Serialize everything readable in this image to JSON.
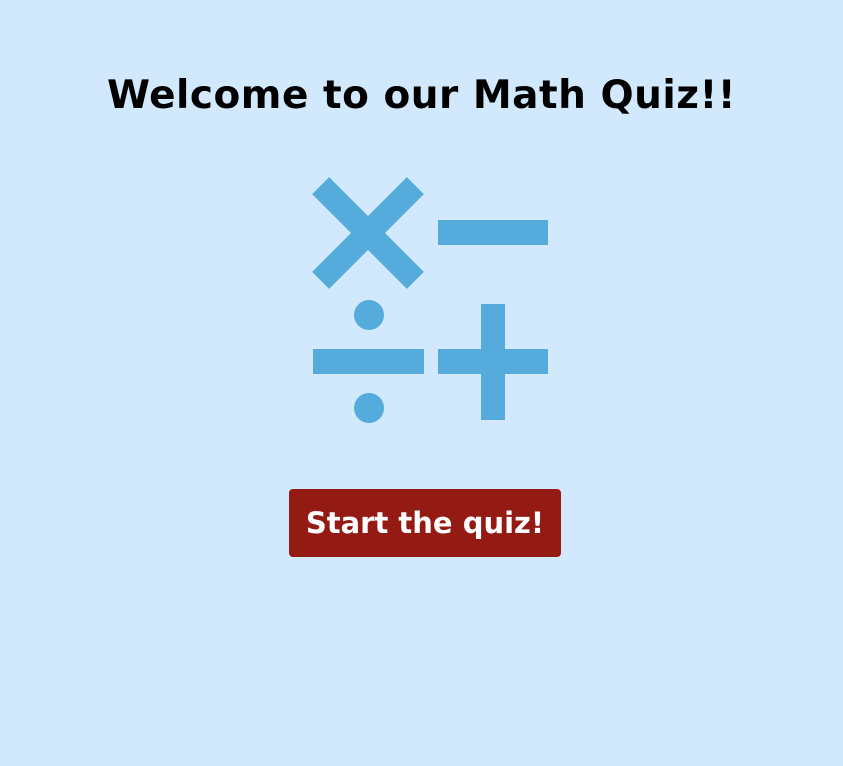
{
  "header": {
    "title": "Welcome to our Math Quiz!!"
  },
  "logo": {
    "icon": "math-operators-icon",
    "color": "#55acdc"
  },
  "actions": {
    "start_label": "Start the quiz!"
  },
  "colors": {
    "background": "#d2e9fd",
    "button": "#931b14",
    "button_text": "#ffffff",
    "title_text": "#000000"
  }
}
